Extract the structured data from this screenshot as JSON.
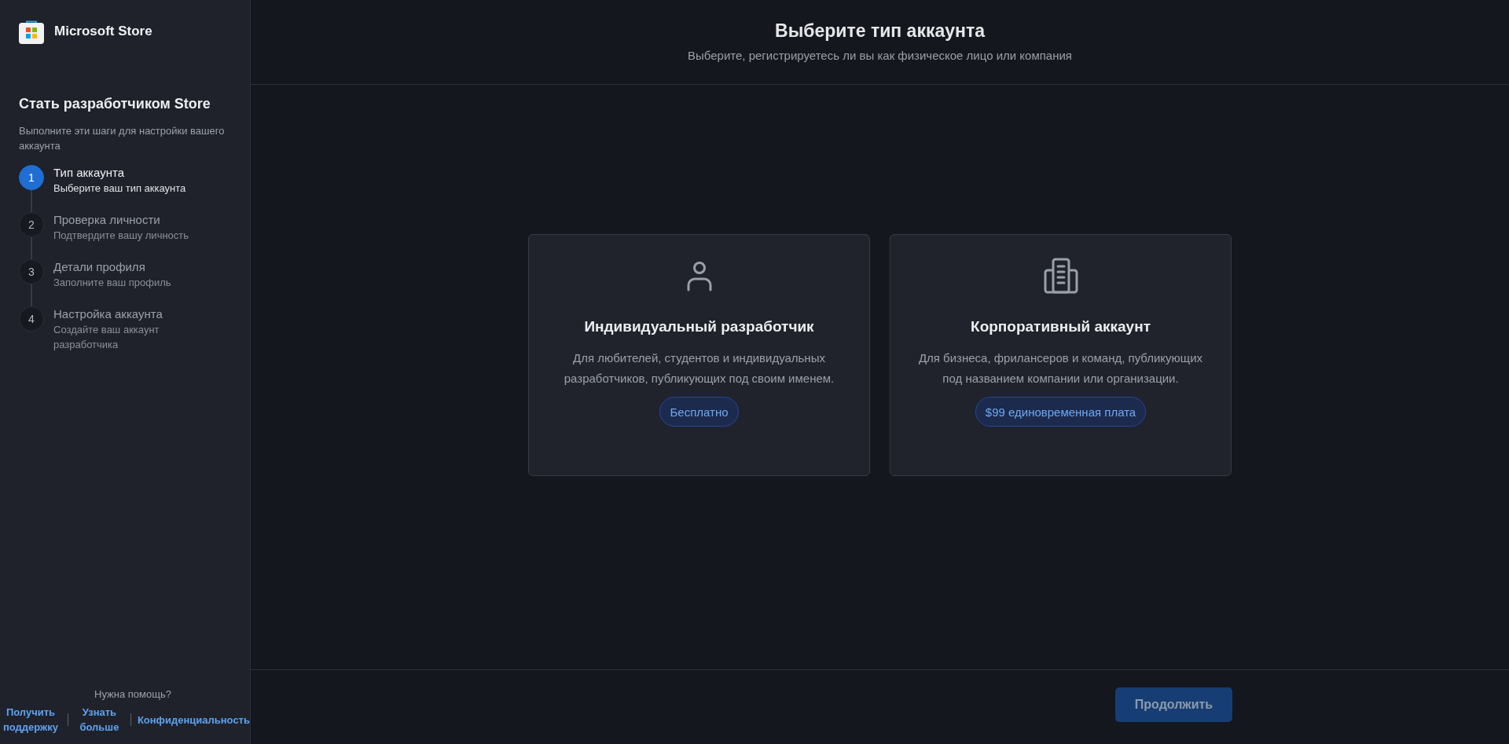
{
  "sidebar": {
    "app_name": "Microsoft Store",
    "title": "Стать разработчиком Store",
    "subtitle": "Выполните эти шаги для настройки вашего аккаунта",
    "steps": [
      {
        "number": "1",
        "title": "Тип аккаунта",
        "description": "Выберите ваш тип аккаунта",
        "selected": true
      },
      {
        "number": "2",
        "title": "Проверка личности",
        "description": "Подтвердите вашу личность",
        "selected": false
      },
      {
        "number": "3",
        "title": "Детали профиля",
        "description": "Заполните ваш профиль",
        "selected": false
      },
      {
        "number": "4",
        "title": "Настройка аккаунта",
        "description": "Создайте ваш аккаунт разработчика",
        "selected": false
      }
    ],
    "help": {
      "label": "Нужна помощь?",
      "links": [
        "Получить поддержку",
        "Узнать больше",
        "Конфиденциальность"
      ]
    }
  },
  "header": {
    "title": "Выберите тип аккаунта",
    "subtitle": "Выберите, регистрируетесь ли вы как физическое лицо или компания"
  },
  "options": [
    {
      "kind": "person",
      "title": "Индивидуальный разработчик",
      "description": "Для любителей, студентов и индивидуальных разработчиков, публикующих под своим именем.",
      "price": "Бесплатно",
      "selected": false
    },
    {
      "kind": "building",
      "title": "Корпоративный аккаунт",
      "description": "Для бизнеса, фрилансеров и команд, публикующих под названием компании или организации.",
      "price": "$99 единовременная плата",
      "selected": false
    }
  ],
  "continue_button": {
    "label": "Продолжить",
    "disabled": true
  }
}
